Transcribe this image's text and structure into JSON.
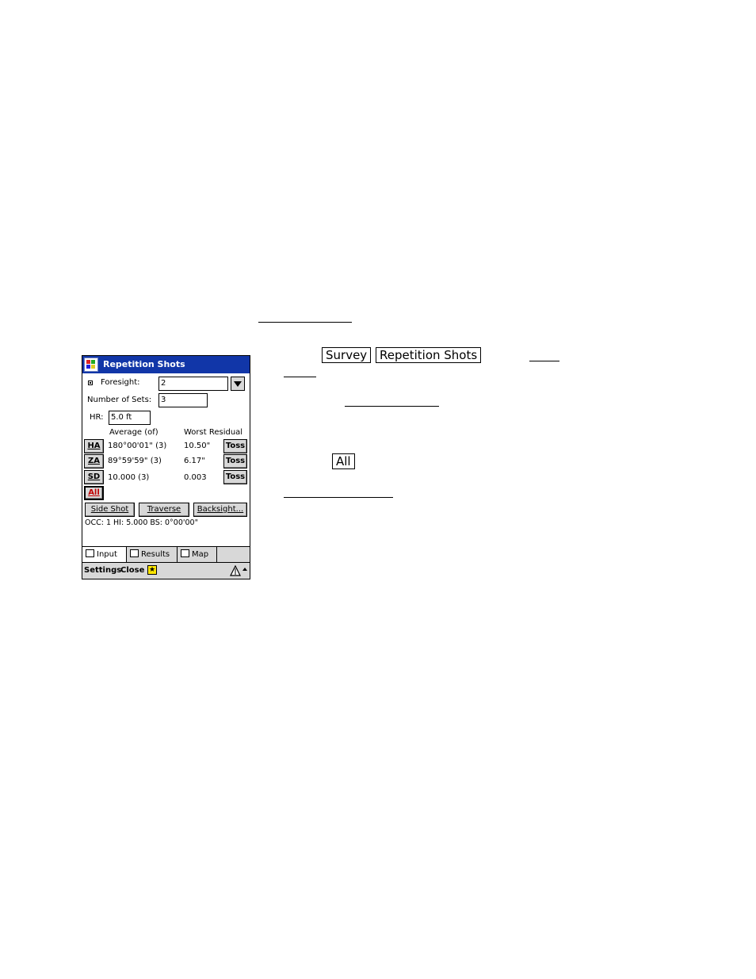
{
  "doc": {
    "menu_keys": [
      "Survey",
      "Repetition Shots"
    ],
    "all_key": "All"
  },
  "window": {
    "title": "Repetition Shots",
    "start_icon": "windows-start-icon"
  },
  "form": {
    "foresight_label": "Foresight:",
    "foresight_value": "2",
    "sets_label": "Number of Sets:",
    "sets_value": "3",
    "hr_label": "HR:",
    "hr_value": "5.0 ft",
    "col_average": "Average (of)",
    "col_worst": "Worst Residual"
  },
  "rows": [
    {
      "key": "HA",
      "average": "180°00'01\" (3)",
      "worst": "10.50\"",
      "toss": "Toss"
    },
    {
      "key": "ZA",
      "average": "89°59'59\" (3)",
      "worst": "6.17\"",
      "toss": "Toss"
    },
    {
      "key": "SD",
      "average": "10.000 (3)",
      "worst": "0.003",
      "toss": "Toss"
    }
  ],
  "all_button": "All",
  "actions": {
    "side_shot": "Side Shot",
    "traverse": "Traverse",
    "backsight": "Backsight..."
  },
  "status_line": "OCC: 1  HI: 5.000  BS: 0°00'00\"",
  "tabs": [
    {
      "label": "Input",
      "icon": "input-tab-icon",
      "active": true
    },
    {
      "label": "Results",
      "icon": "results-tab-icon",
      "active": false
    },
    {
      "label": "Map",
      "icon": "map-tab-icon",
      "active": false
    }
  ],
  "commands": {
    "settings": "Settings",
    "close": "Close",
    "star_icon": "star-icon",
    "instrument_icon": "instrument-icon"
  },
  "colors": {
    "titlebar": "#1136a8",
    "all_text": "#c00000",
    "button_face": "#d8d8d8"
  }
}
